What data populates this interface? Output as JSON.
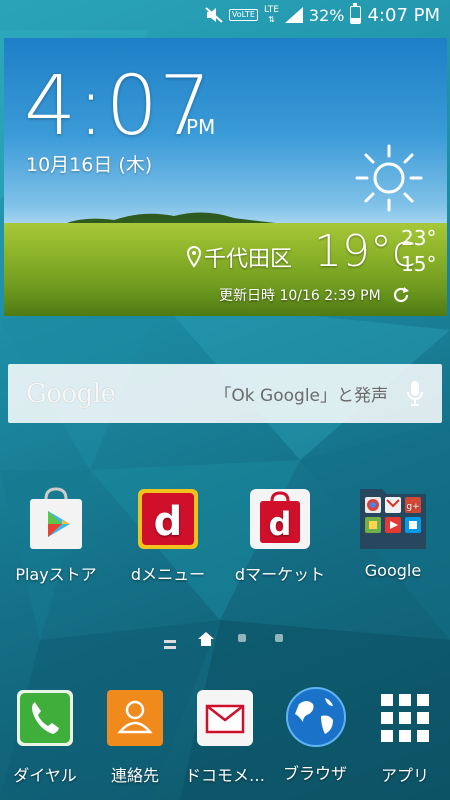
{
  "status_bar": {
    "volte": "VoLTE",
    "network": "LTE",
    "battery": "32%",
    "battery_level": 0.32,
    "time": "4:07 PM"
  },
  "widget": {
    "time": "4:07",
    "ampm": "PM",
    "date": "10月16日 (木)",
    "location": "千代田区",
    "temperature": "19°c",
    "high": "23°",
    "low": "15°",
    "updated": "更新日時 10/16 2:39 PM",
    "weather_icon": "sun-icon"
  },
  "search": {
    "logo": "Google",
    "hint": "「Ok Google」と発声"
  },
  "apps": [
    {
      "label": "Playストア",
      "icon": "play-store-icon"
    },
    {
      "label": "dメニュー",
      "icon": "d-menu-icon"
    },
    {
      "label": "dマーケット",
      "icon": "d-market-icon"
    },
    {
      "label": "Google",
      "icon": "google-folder-icon"
    }
  ],
  "dock": [
    {
      "label": "ダイヤル",
      "icon": "phone-icon"
    },
    {
      "label": "連絡先",
      "icon": "contacts-icon"
    },
    {
      "label": "ドコモメ…",
      "icon": "mail-icon"
    },
    {
      "label": "ブラウザ",
      "icon": "browser-globe-icon"
    },
    {
      "label": "アプリ",
      "icon": "apps-grid-icon"
    }
  ],
  "colors": {
    "wallpaper": "#1d8ea6",
    "d_red": "#d0102b",
    "phone_green": "#3fae3a",
    "contacts_orange": "#f08a1c"
  }
}
